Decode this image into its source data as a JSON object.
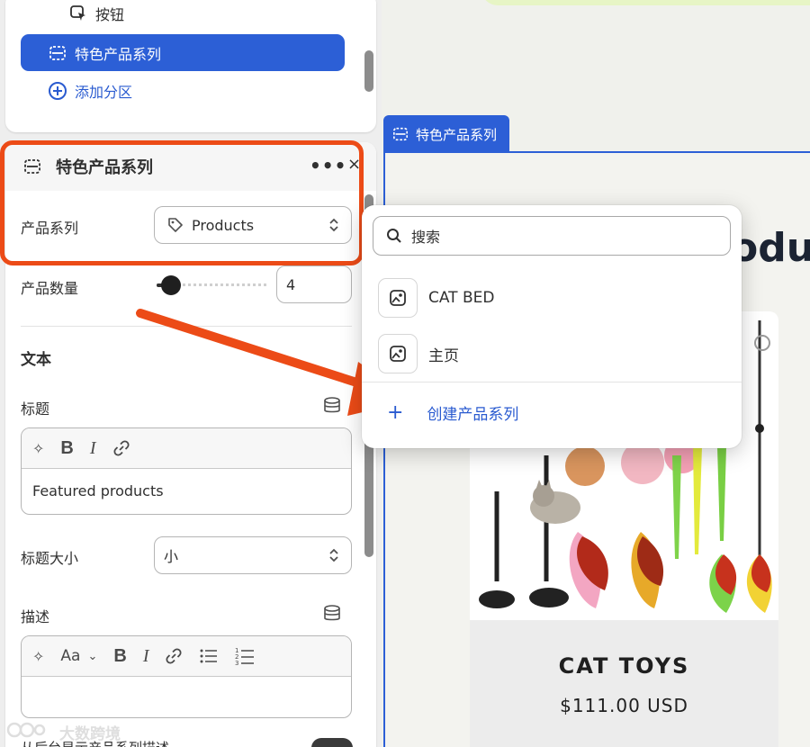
{
  "sidebar": {
    "button_item_label": "按钮",
    "selected_item_label": "特色产品系列",
    "add_section_label": "添加分区"
  },
  "settings": {
    "header_title": "特色产品系列",
    "collection": {
      "label": "产品系列",
      "value": "Products"
    },
    "product_count": {
      "label": "产品数量",
      "value": "4",
      "slider_fraction": 0.1
    },
    "text_section_title": "文本",
    "heading": {
      "label": "标题",
      "value": "Featured products"
    },
    "heading_size": {
      "label": "标题大小",
      "value": "小"
    },
    "description": {
      "label": "描述",
      "value": ""
    },
    "rte_toolbar_text": "Aa",
    "partial_bottom_label": "从后台显示产品系列描述"
  },
  "popover": {
    "search_placeholder": "搜索",
    "items": [
      {
        "label": "CAT BED"
      },
      {
        "label": "主页"
      }
    ],
    "create_label": "创建产品系列"
  },
  "preview": {
    "tab_label": "特色产品系列",
    "partial_heading": "odu",
    "product_title": "CAT TOYS",
    "product_price": "$111.00 USD"
  },
  "watermark": "大数跨境",
  "colors": {
    "accent": "#2c5fd6",
    "highlight": "#ec4b17",
    "link": "#2a5bd0"
  }
}
